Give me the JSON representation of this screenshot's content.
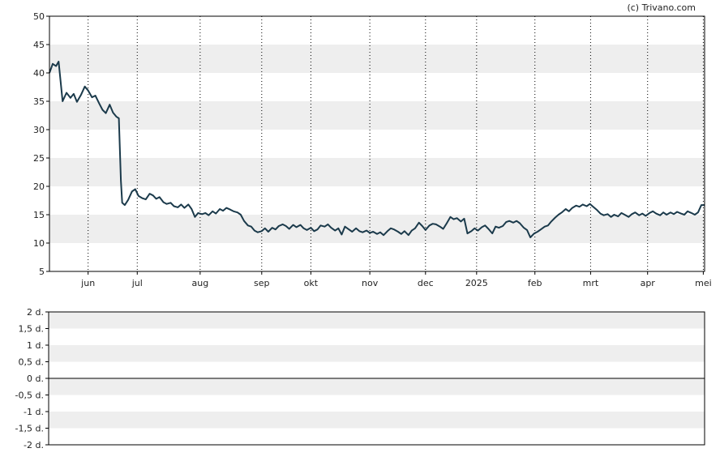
{
  "credit": "(c) Trivano.com",
  "colors": {
    "band": "#eeeeee",
    "line": "#1b3a4b",
    "frame": "#000000",
    "grid": "#000000"
  },
  "chart_data": [
    {
      "type": "line",
      "ylim": [
        5,
        50
      ],
      "yticks": [
        "5",
        "10",
        "15",
        "20",
        "25",
        "30",
        "35",
        "40",
        "45",
        "50"
      ],
      "xticks": [
        {
          "label": "jun",
          "t": 0.059
        },
        {
          "label": "jul",
          "t": 0.134
        },
        {
          "label": "aug",
          "t": 0.23
        },
        {
          "label": "sep",
          "t": 0.324
        },
        {
          "label": "okt",
          "t": 0.399
        },
        {
          "label": "nov",
          "t": 0.489
        },
        {
          "label": "dec",
          "t": 0.574
        },
        {
          "label": "2025",
          "t": 0.652
        },
        {
          "label": "feb",
          "t": 0.741
        },
        {
          "label": "mrt",
          "t": 0.826
        },
        {
          "label": "apr",
          "t": 0.913
        },
        {
          "label": "mei",
          "t": 0.998
        }
      ],
      "series": [
        {
          "values": [
            [
              0.0,
              40.0
            ],
            [
              0.005,
              41.6
            ],
            [
              0.01,
              41.2
            ],
            [
              0.014,
              42.0
            ],
            [
              0.02,
              35.0
            ],
            [
              0.026,
              36.5
            ],
            [
              0.032,
              35.6
            ],
            [
              0.037,
              36.3
            ],
            [
              0.042,
              34.9
            ],
            [
              0.048,
              36.1
            ],
            [
              0.054,
              37.6
            ],
            [
              0.059,
              36.9
            ],
            [
              0.065,
              35.7
            ],
            [
              0.07,
              36.0
            ],
            [
              0.076,
              34.6
            ],
            [
              0.081,
              33.5
            ],
            [
              0.086,
              32.9
            ],
            [
              0.092,
              34.4
            ],
            [
              0.097,
              33.0
            ],
            [
              0.102,
              32.3
            ],
            [
              0.106,
              32.0
            ],
            [
              0.109,
              21.0
            ],
            [
              0.111,
              17.1
            ],
            [
              0.115,
              16.7
            ],
            [
              0.12,
              17.6
            ],
            [
              0.126,
              19.1
            ],
            [
              0.131,
              19.5
            ],
            [
              0.136,
              18.3
            ],
            [
              0.142,
              17.9
            ],
            [
              0.147,
              17.7
            ],
            [
              0.153,
              18.7
            ],
            [
              0.158,
              18.4
            ],
            [
              0.163,
              17.8
            ],
            [
              0.168,
              18.1
            ],
            [
              0.174,
              17.2
            ],
            [
              0.179,
              16.9
            ],
            [
              0.185,
              17.1
            ],
            [
              0.19,
              16.5
            ],
            [
              0.196,
              16.3
            ],
            [
              0.201,
              16.8
            ],
            [
              0.206,
              16.2
            ],
            [
              0.212,
              16.8
            ],
            [
              0.217,
              16.0
            ],
            [
              0.222,
              14.6
            ],
            [
              0.227,
              15.3
            ],
            [
              0.233,
              15.1
            ],
            [
              0.238,
              15.3
            ],
            [
              0.243,
              14.9
            ],
            [
              0.249,
              15.6
            ],
            [
              0.254,
              15.2
            ],
            [
              0.26,
              16.0
            ],
            [
              0.265,
              15.7
            ],
            [
              0.27,
              16.2
            ],
            [
              0.276,
              15.9
            ],
            [
              0.281,
              15.6
            ],
            [
              0.287,
              15.4
            ],
            [
              0.292,
              15.0
            ],
            [
              0.297,
              13.9
            ],
            [
              0.303,
              13.1
            ],
            [
              0.308,
              12.9
            ],
            [
              0.313,
              12.2
            ],
            [
              0.318,
              11.9
            ],
            [
              0.324,
              12.1
            ],
            [
              0.329,
              12.6
            ],
            [
              0.334,
              12.0
            ],
            [
              0.34,
              12.7
            ],
            [
              0.345,
              12.4
            ],
            [
              0.35,
              13.0
            ],
            [
              0.356,
              13.3
            ],
            [
              0.361,
              13.0
            ],
            [
              0.366,
              12.5
            ],
            [
              0.372,
              13.2
            ],
            [
              0.377,
              12.8
            ],
            [
              0.383,
              13.2
            ],
            [
              0.388,
              12.6
            ],
            [
              0.393,
              12.3
            ],
            [
              0.399,
              12.7
            ],
            [
              0.404,
              12.1
            ],
            [
              0.409,
              12.4
            ],
            [
              0.414,
              13.1
            ],
            [
              0.42,
              12.9
            ],
            [
              0.425,
              13.3
            ],
            [
              0.43,
              12.7
            ],
            [
              0.436,
              12.2
            ],
            [
              0.441,
              12.6
            ],
            [
              0.446,
              11.5
            ],
            [
              0.451,
              12.9
            ],
            [
              0.457,
              12.4
            ],
            [
              0.462,
              12.0
            ],
            [
              0.468,
              12.6
            ],
            [
              0.473,
              12.1
            ],
            [
              0.478,
              11.9
            ],
            [
              0.484,
              12.2
            ],
            [
              0.489,
              11.8
            ],
            [
              0.494,
              12.0
            ],
            [
              0.5,
              11.6
            ],
            [
              0.505,
              11.9
            ],
            [
              0.51,
              11.4
            ],
            [
              0.516,
              12.1
            ],
            [
              0.521,
              12.6
            ],
            [
              0.526,
              12.4
            ],
            [
              0.532,
              12.0
            ],
            [
              0.537,
              11.6
            ],
            [
              0.542,
              12.1
            ],
            [
              0.548,
              11.4
            ],
            [
              0.553,
              12.2
            ],
            [
              0.558,
              12.6
            ],
            [
              0.564,
              13.6
            ],
            [
              0.569,
              13.0
            ],
            [
              0.574,
              12.3
            ],
            [
              0.58,
              13.1
            ],
            [
              0.585,
              13.4
            ],
            [
              0.59,
              13.3
            ],
            [
              0.596,
              12.9
            ],
            [
              0.601,
              12.5
            ],
            [
              0.606,
              13.4
            ],
            [
              0.612,
              14.6
            ],
            [
              0.617,
              14.2
            ],
            [
              0.622,
              14.4
            ],
            [
              0.628,
              13.8
            ],
            [
              0.633,
              14.3
            ],
            [
              0.638,
              11.7
            ],
            [
              0.644,
              12.1
            ],
            [
              0.649,
              12.6
            ],
            [
              0.654,
              12.2
            ],
            [
              0.66,
              12.8
            ],
            [
              0.665,
              13.1
            ],
            [
              0.67,
              12.5
            ],
            [
              0.676,
              11.7
            ],
            [
              0.681,
              12.9
            ],
            [
              0.686,
              12.7
            ],
            [
              0.692,
              13.0
            ],
            [
              0.697,
              13.7
            ],
            [
              0.702,
              13.9
            ],
            [
              0.708,
              13.6
            ],
            [
              0.713,
              13.9
            ],
            [
              0.718,
              13.5
            ],
            [
              0.724,
              12.7
            ],
            [
              0.729,
              12.3
            ],
            [
              0.734,
              11.0
            ],
            [
              0.74,
              11.7
            ],
            [
              0.745,
              12.0
            ],
            [
              0.75,
              12.4
            ],
            [
              0.756,
              12.9
            ],
            [
              0.761,
              13.1
            ],
            [
              0.766,
              13.8
            ],
            [
              0.772,
              14.5
            ],
            [
              0.777,
              15.0
            ],
            [
              0.782,
              15.4
            ],
            [
              0.788,
              16.0
            ],
            [
              0.793,
              15.6
            ],
            [
              0.798,
              16.2
            ],
            [
              0.804,
              16.6
            ],
            [
              0.809,
              16.4
            ],
            [
              0.814,
              16.8
            ],
            [
              0.82,
              16.5
            ],
            [
              0.825,
              16.9
            ],
            [
              0.83,
              16.4
            ],
            [
              0.836,
              15.8
            ],
            [
              0.841,
              15.2
            ],
            [
              0.846,
              14.9
            ],
            [
              0.852,
              15.1
            ],
            [
              0.857,
              14.6
            ],
            [
              0.862,
              15.0
            ],
            [
              0.868,
              14.7
            ],
            [
              0.873,
              15.3
            ],
            [
              0.878,
              15.0
            ],
            [
              0.884,
              14.6
            ],
            [
              0.889,
              15.1
            ],
            [
              0.894,
              15.4
            ],
            [
              0.9,
              14.9
            ],
            [
              0.905,
              15.2
            ],
            [
              0.91,
              14.8
            ],
            [
              0.916,
              15.3
            ],
            [
              0.921,
              15.6
            ],
            [
              0.926,
              15.2
            ],
            [
              0.932,
              14.9
            ],
            [
              0.937,
              15.4
            ],
            [
              0.942,
              15.0
            ],
            [
              0.948,
              15.4
            ],
            [
              0.953,
              15.1
            ],
            [
              0.958,
              15.5
            ],
            [
              0.964,
              15.2
            ],
            [
              0.969,
              15.0
            ],
            [
              0.974,
              15.6
            ],
            [
              0.98,
              15.3
            ],
            [
              0.985,
              15.0
            ],
            [
              0.99,
              15.4
            ],
            [
              0.995,
              16.7
            ],
            [
              1.0,
              16.7
            ]
          ]
        }
      ]
    },
    {
      "type": "line",
      "ylim": [
        -2,
        2
      ],
      "yticks": [
        "-2 d.",
        "-1,5 d.",
        "-1 d.",
        "-0,5 d.",
        "0 d.",
        "0,5 d.",
        "1 d.",
        "1,5 d.",
        "2 d."
      ],
      "series": []
    }
  ]
}
